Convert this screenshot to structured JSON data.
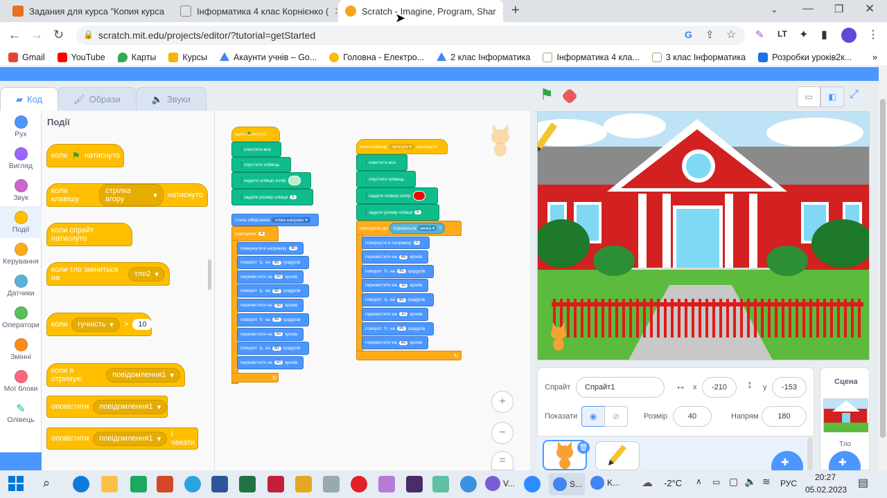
{
  "browser": {
    "tabs": [
      {
        "title": "Задания для курса \"Копия курса",
        "color": "#e8711c"
      },
      {
        "title": "Інформатика 4 клас Корнієнко (",
        "color": "#888888"
      },
      {
        "title": "Scratch - Imagine, Program, Shar",
        "color": "#f9a51c"
      }
    ],
    "new_tab": "+",
    "url": "scratch.mit.edu/projects/editor/?tutorial=getStarted",
    "bookmarks": [
      {
        "label": "Gmail",
        "color": "#ea4335"
      },
      {
        "label": "YouTube",
        "color": "#ff0000"
      },
      {
        "label": "Карты",
        "color": "#34a853"
      },
      {
        "label": "Курсы",
        "color": "#f4b400"
      },
      {
        "label": "Акаунти учнів – Go...",
        "color": "#4285f4"
      },
      {
        "label": "Головна - Електро...",
        "color": "#fbbc05"
      },
      {
        "label": "2 клас Інформатика",
        "color": "#4285f4"
      },
      {
        "label": "Інформатика 4 кла...",
        "color": "#b89b72"
      },
      {
        "label": "3 клас Інформатика",
        "color": "#b89b72"
      },
      {
        "label": "Розробки уроків2к...",
        "color": "#1a73e8"
      }
    ],
    "more": "»"
  },
  "scratch": {
    "tabs": {
      "code": "Код",
      "costumes": "Образи",
      "sounds": "Звуки"
    },
    "categories": [
      {
        "label": "Рух",
        "color": "#4c97ff"
      },
      {
        "label": "Вигляд",
        "color": "#9966ff"
      },
      {
        "label": "Звук",
        "color": "#cf63cf"
      },
      {
        "label": "Події",
        "color": "#ffbf00"
      },
      {
        "label": "Керування",
        "color": "#ffab19"
      },
      {
        "label": "Датчики",
        "color": "#5cb1d6"
      },
      {
        "label": "Оператори",
        "color": "#59c059"
      },
      {
        "label": "Змінні",
        "color": "#ff8c1a"
      },
      {
        "label": "Мої блоки",
        "color": "#ff6680"
      },
      {
        "label": "Олівець",
        "color": "#0fbd8c"
      }
    ],
    "palette": {
      "title": "Події",
      "b1_a": "коли",
      "b1_b": "натиснуто",
      "b2_a": "коли клавішу",
      "b2_key": "стрілка вгору",
      "b2_b": "натиснуто",
      "b3": "коли спрайт натиснуто",
      "b4_a": "коли тло зміниться на",
      "b4_val": "тло2",
      "b5_a": "коли",
      "b5_val": "гучність",
      "b5_op": ">",
      "b5_num": "10",
      "b6_a": "коли я отримую",
      "b6_val": "повідомлення1",
      "b7_a": "оповістити",
      "b7_val": "повідомлення1",
      "b8_a": "оповістити",
      "b8_val": "повідомлення1",
      "b8_b": "і чекати"
    },
    "script1": {
      "hat": "коли  натиснуто",
      "clear": "очистити все",
      "pen_down": "опустити олівець",
      "set_color": "надати олівцю колір",
      "set_size": "задати розмір олівця",
      "size_val": "5",
      "rot_style": "стиль обертання",
      "rot_val": "зліва-направо",
      "repeat": "повторити",
      "repeat_val": "4",
      "point": "повернути в напрямку",
      "point_val": "90",
      "steps": [
        {
          "a": "поворот",
          "v": "90",
          "b": "градусів"
        },
        {
          "a": "перемістити на",
          "v": "50",
          "b": "кроків"
        },
        {
          "a": "поворот",
          "v": "90",
          "b": "градусів"
        },
        {
          "a": "перемістити на",
          "v": "50",
          "b": "кроків"
        },
        {
          "a": "поворот",
          "v": "90",
          "b": "градусів"
        },
        {
          "a": "перемістити на",
          "v": "50",
          "b": "кроків"
        },
        {
          "a": "поворот",
          "v": "90",
          "b": "градусів"
        },
        {
          "a": "перемістити на",
          "v": "50",
          "b": "кроків"
        }
      ]
    },
    "script2": {
      "hat": "коли клавішу",
      "hat_key": "пропуск",
      "hat_b": "натиснуто",
      "clear": "очистити все",
      "pen_down": "опустити олівець",
      "set_color": "надати олівцю колір",
      "set_size": "задати розмір олівця",
      "size_val": "5",
      "repeat_until": "повторити до",
      "touch": "торкається",
      "touch_val": "межа",
      "q": "?",
      "point": "повернути в напрямку",
      "point_val": "0",
      "steps": [
        {
          "a": "перемістити на",
          "v": "40",
          "b": "кроків"
        },
        {
          "a": "поворот",
          "v": "45",
          "b": "градусів"
        },
        {
          "a": "перемістити на",
          "v": "10",
          "b": "кроків"
        },
        {
          "a": "поворот",
          "v": "90",
          "b": "градусів"
        },
        {
          "a": "перемістити на",
          "v": "10",
          "b": "кроків"
        },
        {
          "a": "поворот",
          "v": "45",
          "b": "градусів"
        },
        {
          "a": "перемістити на",
          "v": "40",
          "b": "кроків"
        }
      ]
    },
    "zoom_in": "+",
    "zoom_out": "−",
    "zoom_reset": "=",
    "sprite_panel": {
      "sprite_label": "Спрайт",
      "sprite_name": "Спрайт1",
      "x_label": "x",
      "x": "-210",
      "y_label": "y",
      "y": "-153",
      "show_label": "Показати",
      "size_label": "Розмір",
      "size": "40",
      "dir_label": "Напрям",
      "dir": "180"
    },
    "scene": {
      "title": "Сцена",
      "backdrop_label": "Тло"
    }
  },
  "taskbar": {
    "weather": "-2°C",
    "lang": "РУС",
    "time": "20:27",
    "date": "05.02.2023",
    "apps": [
      {
        "label": "V...",
        "color": "#7b5cd6"
      },
      {
        "label": "S...",
        "color": "#4285f4"
      },
      {
        "label": "K...",
        "color": "#4285f4"
      }
    ]
  }
}
